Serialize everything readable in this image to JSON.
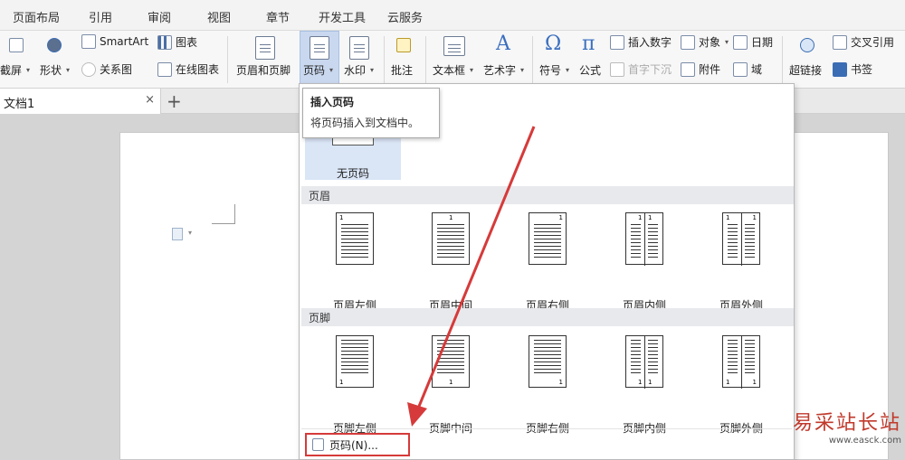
{
  "menu_tabs": [
    "页面布局",
    "引用",
    "审阅",
    "视图",
    "章节",
    "开发工具",
    "云服务"
  ],
  "ribbon": {
    "screenshot": "截屏",
    "shape": "形状",
    "smartart": "SmartArt",
    "relation": "关系图",
    "chart": "图表",
    "online_chart": "在线图表",
    "header_footer": "页眉和页脚",
    "page_number": "页码",
    "watermark": "水印",
    "comment": "批注",
    "textbox": "文本框",
    "wordart": "艺术字",
    "symbol": "符号",
    "symbol_glyph": "Ω",
    "formula": "公式",
    "formula_glyph": "π",
    "insert_number": "插入数字",
    "object": "对象",
    "date": "日期",
    "drop_cap": "首字下沉",
    "attachment": "附件",
    "field": "域",
    "hyperlink": "超链接",
    "cross_ref": "交叉引用",
    "bookmark": "书签"
  },
  "doc_tab": {
    "name": "文档1",
    "close": "×",
    "add": "+"
  },
  "tooltip": {
    "title": "插入页码",
    "desc": "将页码插入到文档中。"
  },
  "dropdown": {
    "none_label": "无页码",
    "header_section": "页眉",
    "footer_section": "页脚",
    "header_options": [
      "页眉左侧",
      "页眉中间",
      "页眉右侧",
      "页眉内侧",
      "页眉外侧"
    ],
    "footer_options": [
      "页脚左侧",
      "页脚中间",
      "页脚右侧",
      "页脚内侧",
      "页脚外侧"
    ],
    "page_number_dialog": "页码(N)..."
  },
  "watermark": {
    "text": "易采站长站",
    "url": "www.easck.com"
  },
  "colors": {
    "highlight": "#c9d8ef",
    "arrow": "#d63a3a",
    "accent": "#3a6fbf"
  }
}
